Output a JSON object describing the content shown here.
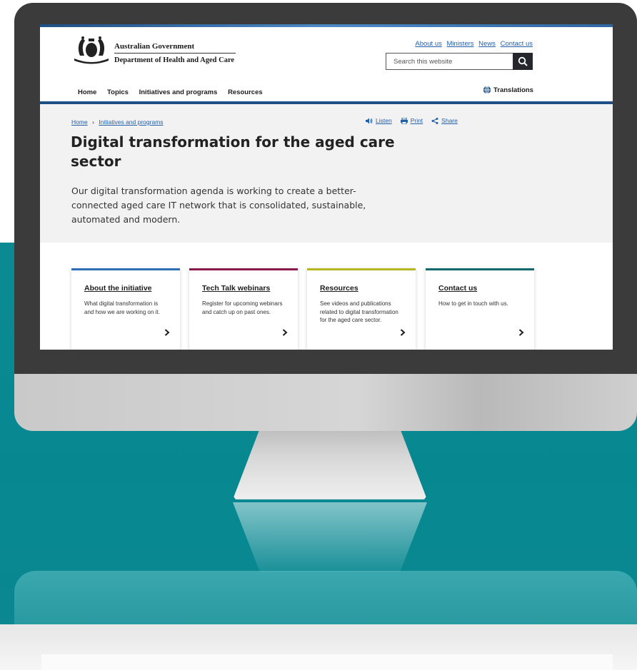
{
  "colors": {
    "teal": "#0b8a93",
    "gov_blue": "#1e4f86",
    "link": "#2360a8",
    "card_bars": [
      "#2c6fb7",
      "#8b1a4c",
      "#b6b61f",
      "#13686e"
    ]
  },
  "header": {
    "gov_name": "Australian Government",
    "dept_name": "Department of Health and Aged Care",
    "util_links": [
      "About us",
      "Ministers",
      "News",
      "Contact us"
    ],
    "search": {
      "placeholder": "Search this website",
      "icon": "search-icon"
    }
  },
  "nav": {
    "items": [
      "Home",
      "Topics",
      "Initiatives and programs",
      "Resources"
    ],
    "translations": {
      "label": "Translations",
      "icon": "globe-icon"
    }
  },
  "breadcrumb": {
    "home": "Home",
    "separator": "›",
    "current": "Initiatives and programs"
  },
  "page_actions": [
    {
      "label": "Listen",
      "icon": "speaker-icon"
    },
    {
      "label": "Print",
      "icon": "printer-icon"
    },
    {
      "label": "Share",
      "icon": "share-icon"
    }
  ],
  "hero": {
    "title": "Digital transformation for the aged care sector",
    "intro": "Our digital transformation agenda is working to create a better-connected aged care IT network that is consolidated, sustainable, automated and modern."
  },
  "cards": [
    {
      "title": "About the initiative",
      "desc": "What digital transformation is and how we are working on it.",
      "icon": "chevron-right-icon"
    },
    {
      "title": "Tech Talk webinars",
      "desc": "Register for upcoming webinars and catch up on past ones.",
      "icon": "chevron-right-icon"
    },
    {
      "title": "Resources",
      "desc": "See videos and publications related to digital transformation for the aged care sector.",
      "icon": "chevron-right-icon"
    },
    {
      "title": "Contact us",
      "desc": "How to get in touch with us.",
      "icon": "chevron-right-icon"
    }
  ]
}
